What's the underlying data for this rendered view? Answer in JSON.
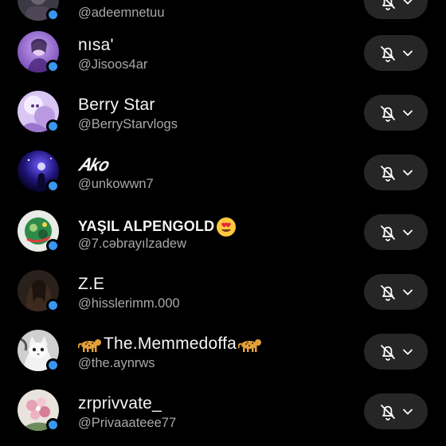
{
  "top_partial": {
    "handle": "@adeemnetuu"
  },
  "users": [
    {
      "name": "nısa'",
      "handle": "@Jisoos4ar",
      "avatar": "purple-portrait",
      "online": true,
      "bell": "bell-off-icon"
    },
    {
      "name": "Berry Star",
      "handle": "@BerryStarvlogs",
      "avatar": "lavender-cartoon",
      "online": true,
      "bell": "bell-off-icon"
    },
    {
      "name": "𝐴𝑘𝑜",
      "handle": "@unkowwn7",
      "avatar": "blue-night-figure",
      "online": true,
      "bell": "bell-off-icon"
    },
    {
      "name": "YAŞIL ALPENGOLD",
      "name_suffix_icon": "heart-eyes-emoji",
      "handle": "@7.cəbrayılzadew",
      "avatar": "green-sticker",
      "online": true,
      "bell": "bell-off-icon"
    },
    {
      "name": "Z.E",
      "handle": "@hisslerimm.000",
      "avatar": "dark-hair-portrait",
      "online": true,
      "bell": "bell-off-icon"
    },
    {
      "name": "The.Memmedoffa",
      "name_prefix_icon": "leopard-emoji",
      "name_suffix_icon": "leopard-emoji",
      "handle": "@the.aynrws",
      "avatar": "bw-cat",
      "online": true,
      "bell": "bell-off-icon"
    },
    {
      "name": "zrprivvate_",
      "handle": "@Privaaateee77",
      "avatar": "flowers-photo",
      "online": true,
      "bell": "bell-off-icon"
    }
  ],
  "colors": {
    "background": "#000000",
    "button": "#262626",
    "online": "#3897f0",
    "secondary_text": "#a8a8a8"
  }
}
